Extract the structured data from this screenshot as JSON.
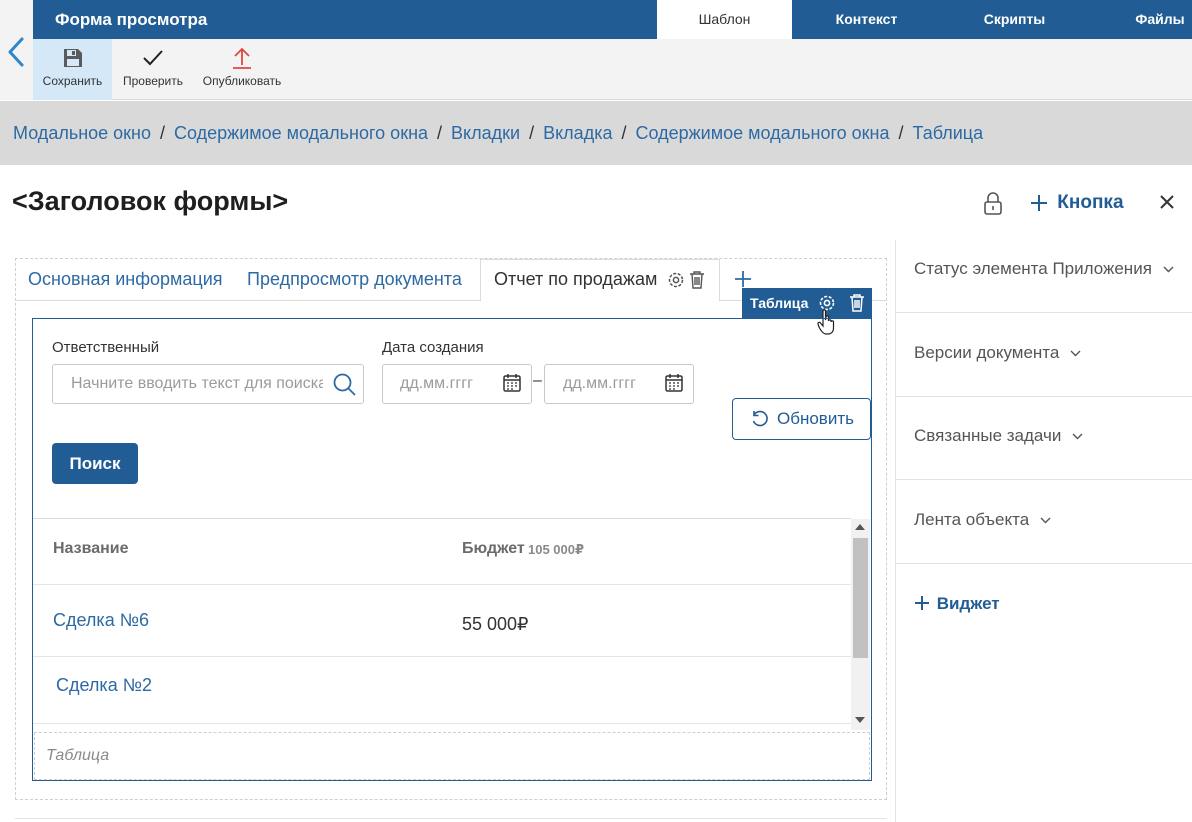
{
  "window": {
    "title": "Форма просмотра",
    "tabs": [
      "Шаблон",
      "Контекст",
      "Скрипты",
      "Файлы"
    ]
  },
  "toolbar": {
    "save_label": "Сохранить",
    "check_label": "Проверить",
    "publish_label": "Опубликовать"
  },
  "breadcrumb": {
    "items": [
      "Модальное окно",
      "Содержимое модального окна",
      "Вкладки",
      "Вкладка",
      "Содержимое модального окна",
      "Таблица"
    ],
    "separator": "/"
  },
  "form": {
    "title": "<Заголовок формы>",
    "add_button": "Кнопка",
    "tabs": [
      "Основная информация",
      "Предпросмотр документа",
      "Отчет по продажам"
    ],
    "selected_widget_label": "Таблица",
    "filters": {
      "responsible_label": "Ответственный",
      "responsible_placeholder": "Начните вводить текст для поиска",
      "date_label": "Дата создания",
      "date_from_placeholder": "дд.мм.гггг",
      "date_to_placeholder": "дд.мм.гггг",
      "date_dash": "–",
      "refresh_label": "Обновить",
      "search_label": "Поиск"
    },
    "table": {
      "columns": [
        "Название",
        "Бюджет"
      ],
      "budget_total": "105 000₽",
      "rows": [
        {
          "name": "Сделка №6",
          "budget": "55 000₽"
        },
        {
          "name": "Сделка №2",
          "budget": ""
        }
      ]
    },
    "placeholder": "Таблица"
  },
  "right_panel": {
    "items": [
      "Статус элемента Приложения",
      "Версии документа",
      "Связанные задачи",
      "Лента объекта"
    ],
    "add_widget": "Виджет"
  },
  "colors": {
    "brand": "#215d94",
    "link": "#2d6aa3",
    "active_tool": "#d4e8f7",
    "breadcrumb_bg": "#d9d9d9"
  }
}
